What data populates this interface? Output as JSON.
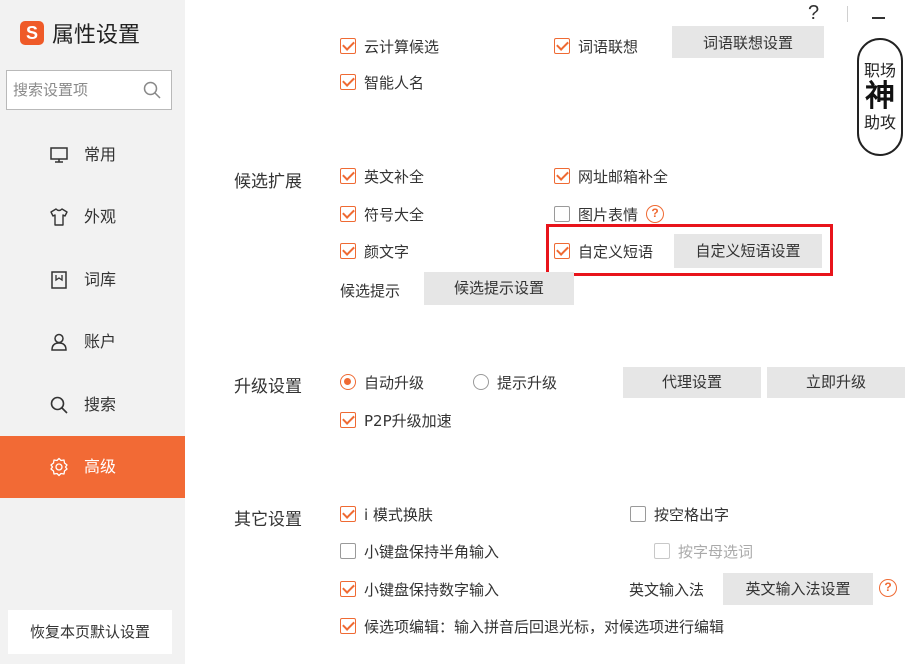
{
  "app": {
    "title": "属性设置"
  },
  "search": {
    "placeholder": "搜索设置项"
  },
  "sidebar": {
    "items": [
      {
        "label": "常用",
        "icon": "monitor-icon"
      },
      {
        "label": "外观",
        "icon": "shirt-icon"
      },
      {
        "label": "词库",
        "icon": "dictionary-icon"
      },
      {
        "label": "账户",
        "icon": "user-icon"
      },
      {
        "label": "搜索",
        "icon": "search-icon"
      },
      {
        "label": "高级",
        "icon": "gear-icon",
        "active": true
      }
    ],
    "restore_label": "恢复本页默认设置"
  },
  "window": {
    "help": "?"
  },
  "stamp": {
    "top": "职场",
    "middle": "神",
    "bottom": "助攻"
  },
  "top_partial": {
    "left": "云计算候选",
    "right": "词语联想",
    "button": "词语联想设置"
  },
  "smart_name": {
    "label": "智能人名",
    "checked": true
  },
  "candidate": {
    "section": "候选扩展",
    "english_complete": "英文补全",
    "url_email": "网址邮箱补全",
    "symbols": "符号大全",
    "image_emoji": "图片表情",
    "kaomoji": "颜文字",
    "custom_phrase": "自定义短语",
    "custom_phrase_button": "自定义短语设置",
    "hint_label": "候选提示",
    "hint_button": "候选提示设置"
  },
  "upgrade": {
    "section": "升级设置",
    "auto": "自动升级",
    "prompt": "提示升级",
    "proxy_button": "代理设置",
    "now_button": "立即升级",
    "p2p": "P2P升级加速"
  },
  "other": {
    "section": "其它设置",
    "i_mode": "i 模式换肤",
    "space_output": "按空格出字",
    "keypad_half": "小键盘保持半角输入",
    "letter_select": "按字母选词",
    "keypad_number": "小键盘保持数字输入",
    "english_ime_label": "英文输入法",
    "english_ime_button": "英文输入法设置",
    "edit_candidate": "候选项编辑：输入拼音后回退光标，对候选项进行编辑"
  },
  "colors": {
    "accent": "#f26a35",
    "highlight_box": "#e8141b",
    "sidebar_bg": "#f2f2f2",
    "button_bg": "#e6e6e6"
  }
}
